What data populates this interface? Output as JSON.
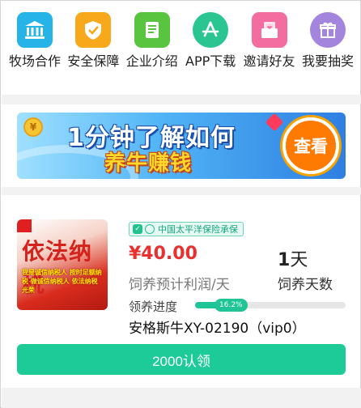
{
  "menu": {
    "items": [
      {
        "label": "牧场合作",
        "icon": "bank-icon",
        "color": "#26b4e8"
      },
      {
        "label": "安全保障",
        "icon": "shield-check-icon",
        "color": "#f7a81b"
      },
      {
        "label": "企业介绍",
        "icon": "document-icon",
        "color": "#58c43f"
      },
      {
        "label": "APP下载",
        "icon": "app-store-icon",
        "color": "#2bc592"
      },
      {
        "label": "邀请好友",
        "icon": "invite-letter-icon",
        "color": "#f36da0"
      },
      {
        "label": "我要抽奖",
        "icon": "gift-icon",
        "color": "#a385de"
      }
    ]
  },
  "banner": {
    "line1": "1分钟了解如何",
    "line2": "养牛赚钱",
    "button": "查看",
    "coin": "¥"
  },
  "product": {
    "image_title": "依法纳税",
    "image_subtitle": "我是诚信纳税人 按时足额纳税 做诚信纳税人 依法纳税光荣",
    "insurance_badge": "中国太平洋保险承保",
    "price": "¥40.00",
    "price_label": "饲养预计利润/天",
    "days_number": "1",
    "days_unit": "天",
    "days_label": "饲养天数",
    "progress_label": "领养进度",
    "progress_text": "16.2%",
    "progress_value": 16.2,
    "name": "安格斯牛XY-02190（vip0）",
    "claim_button": "2000认领"
  },
  "colors": {
    "accent": "#1ccb98",
    "price": "#e9302f"
  }
}
